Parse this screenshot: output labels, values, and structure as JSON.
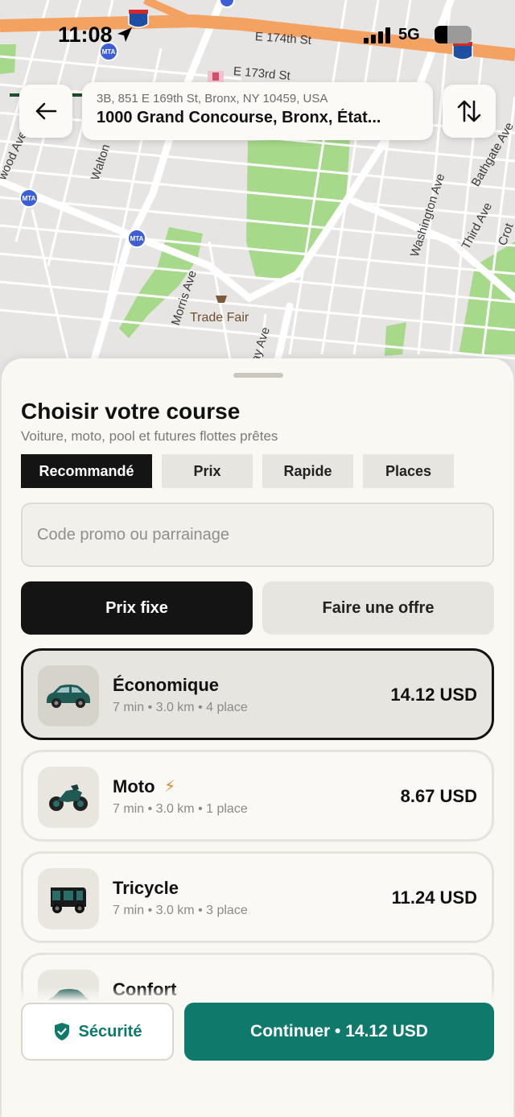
{
  "status_bar": {
    "time": "11:08",
    "network": "5G",
    "battery_level": 0.35
  },
  "map": {
    "labels": {
      "e174": "E 174th St",
      "e173": "E 173rd St",
      "walton": "Walton",
      "wood_ave": "wood Ave",
      "morris": "Morris Ave",
      "trade_fair": "Trade Fair",
      "clay": "lay Ave",
      "washington": "Washington Ave",
      "bathgate": "Bathgate Ave",
      "third": "Third Ave",
      "crotona": "Crot",
      "i95": "95"
    }
  },
  "route": {
    "from": "3B, 851 E 169th St, Bronx, NY 10459, USA",
    "to": "1000 Grand Concourse, Bronx, État..."
  },
  "sheet": {
    "title": "Choisir votre course",
    "subtitle": "Voiture, moto, pool et futures flottes prêtes",
    "filters": [
      "Recommandé",
      "Prix",
      "Rapide",
      "Places"
    ],
    "active_filter": "Recommandé",
    "promo_placeholder": "Code promo ou parrainage",
    "modes": {
      "fixed": "Prix fixe",
      "offer": "Faire une offre"
    },
    "rides": [
      {
        "name": "Économique",
        "meta": "7 min • 3.0 km • 4 place",
        "price": "14.12 USD",
        "selected": true,
        "icon": "car-icon"
      },
      {
        "name": "Moto",
        "meta": "7 min • 3.0 km • 1 place",
        "price": "8.67 USD",
        "selected": false,
        "icon": "motorcycle-icon",
        "badge": "⚡"
      },
      {
        "name": "Tricycle",
        "meta": "7 min • 3.0 km • 3 place",
        "price": "11.24 USD",
        "selected": false,
        "icon": "tricycle-icon"
      },
      {
        "name": "Confort",
        "meta": "",
        "price": "",
        "selected": false,
        "icon": "car-icon"
      }
    ]
  },
  "actions": {
    "safety": "Sécurité",
    "continue": "Continuer • 14.12 USD"
  },
  "colors": {
    "accent": "#0f7a6c",
    "dark": "#141414",
    "map_highway": "#f4a261",
    "map_park": "#a6d98a"
  }
}
